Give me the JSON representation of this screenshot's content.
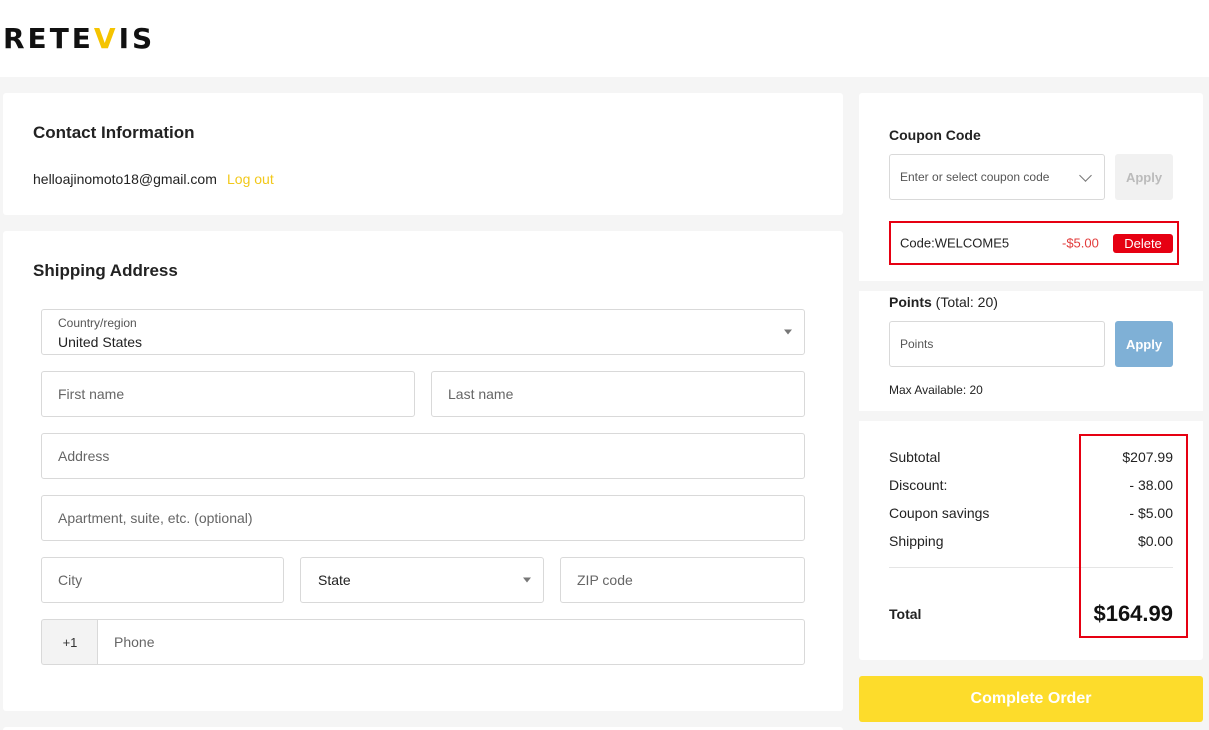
{
  "brand": {
    "logo_a": "RETE",
    "logo_b": "V",
    "logo_c": "IS"
  },
  "contact": {
    "title": "Contact Information",
    "email": "helloajinomoto18@gmail.com",
    "logout": "Log out"
  },
  "shipping": {
    "title": "Shipping Address",
    "country_label": "Country/region",
    "country_value": "United States",
    "first_name": "First name",
    "last_name": "Last name",
    "address": "Address",
    "apartment": "Apartment, suite, etc. (optional)",
    "city": "City",
    "state": "State",
    "zip": "ZIP code",
    "phone_prefix": "+1",
    "phone": "Phone"
  },
  "coupon": {
    "title": "Coupon Code",
    "placeholder": "Enter or select coupon code",
    "apply": "Apply",
    "applied_code": "Code:WELCOME5",
    "applied_amount": "-$5.00",
    "delete": "Delete"
  },
  "points": {
    "title": "Points",
    "total": "(Total: 20)",
    "placeholder": "Points",
    "apply": "Apply",
    "max": "Max Available: 20"
  },
  "summary": {
    "rows": [
      {
        "label": "Subtotal",
        "value": "$207.99"
      },
      {
        "label": "Discount:",
        "value": "- 38.00"
      },
      {
        "label": "Coupon savings",
        "value": "- $5.00"
      },
      {
        "label": "Shipping",
        "value": "$0.00"
      }
    ],
    "total_label": "Total",
    "total_value": "$164.99"
  },
  "complete_order": "Complete Order",
  "colors": {
    "accent": "#fddc2b",
    "danger": "#e60012",
    "apply_blue": "#7fb0d6"
  }
}
